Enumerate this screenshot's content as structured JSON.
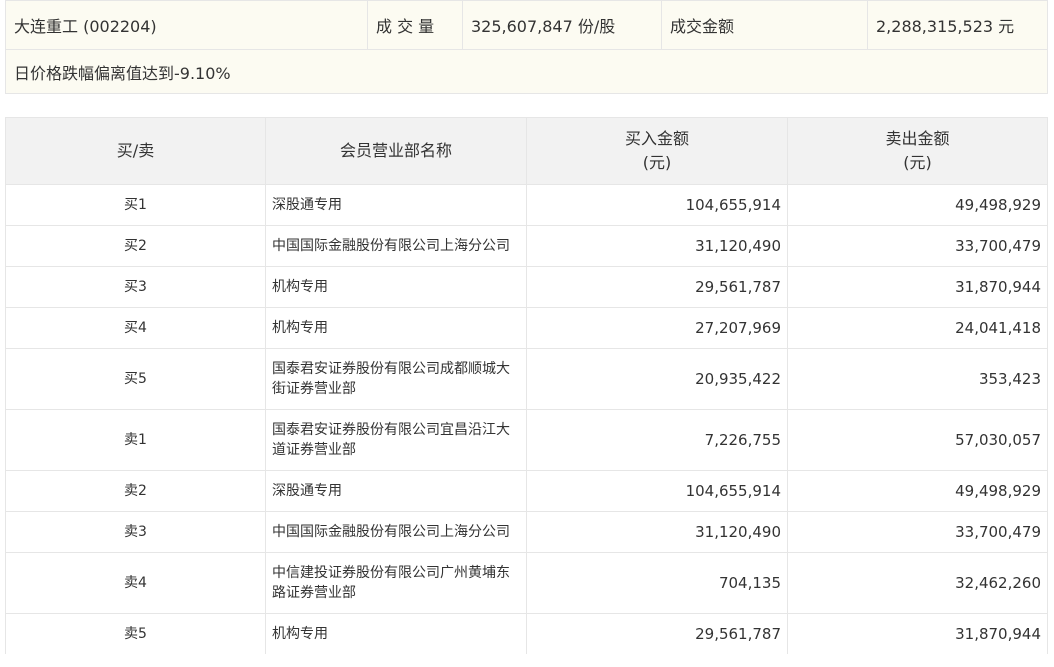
{
  "summary": {
    "stock": "大连重工 (002204)",
    "volume_label": "成 交 量",
    "volume_value": "325,607,847 份/股",
    "amount_label": "成交金额",
    "amount_value": "2,288,315,523 元",
    "reason": "日价格跌幅偏离值达到-9.10%"
  },
  "table": {
    "headers": {
      "side": "买/卖",
      "name": "会员营业部名称",
      "buy": "买入金额\n(元)",
      "sell": "卖出金额\n(元)"
    },
    "rows": [
      {
        "side": "买1",
        "name": "深股通专用",
        "buy": "104,655,914",
        "sell": "49,498,929"
      },
      {
        "side": "买2",
        "name": "中国国际金融股份有限公司上海分公司",
        "buy": "31,120,490",
        "sell": "33,700,479"
      },
      {
        "side": "买3",
        "name": "机构专用",
        "buy": "29,561,787",
        "sell": "31,870,944"
      },
      {
        "side": "买4",
        "name": "机构专用",
        "buy": "27,207,969",
        "sell": "24,041,418"
      },
      {
        "side": "买5",
        "name": "国泰君安证券股份有限公司成都顺城大街证券营业部",
        "buy": "20,935,422",
        "sell": "353,423"
      },
      {
        "side": "卖1",
        "name": "国泰君安证券股份有限公司宜昌沿江大道证券营业部",
        "buy": "7,226,755",
        "sell": "57,030,057"
      },
      {
        "side": "卖2",
        "name": "深股通专用",
        "buy": "104,655,914",
        "sell": "49,498,929"
      },
      {
        "side": "卖3",
        "name": "中国国际金融股份有限公司上海分公司",
        "buy": "31,120,490",
        "sell": "33,700,479"
      },
      {
        "side": "卖4",
        "name": "中信建投证券股份有限公司广州黄埔东路证券营业部",
        "buy": "704,135",
        "sell": "32,462,260"
      },
      {
        "side": "卖5",
        "name": "机构专用",
        "buy": "29,561,787",
        "sell": "31,870,944"
      }
    ]
  }
}
